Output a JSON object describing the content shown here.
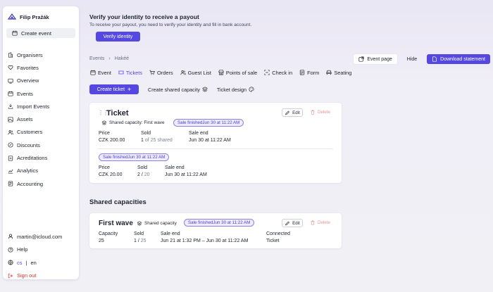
{
  "user": {
    "name": "Filip Pražák"
  },
  "sidebar": {
    "create_label": "Create event",
    "items": [
      {
        "label": "Organisers",
        "icon": "building-icon"
      },
      {
        "label": "Favorites",
        "icon": "heart-icon"
      },
      {
        "label": "Overview",
        "icon": "overview-icon"
      },
      {
        "label": "Events",
        "icon": "calendar-icon"
      },
      {
        "label": "Import Events",
        "icon": "import-icon"
      },
      {
        "label": "Assets",
        "icon": "assets-icon"
      },
      {
        "label": "Customers",
        "icon": "users-icon"
      },
      {
        "label": "Discounts",
        "icon": "discount-icon"
      },
      {
        "label": "Acreditations",
        "icon": "badge-icon"
      },
      {
        "label": "Analytics",
        "icon": "chart-icon"
      },
      {
        "label": "Accounting",
        "icon": "accounting-icon"
      }
    ],
    "email": "martin@icloud.com",
    "help": "Help",
    "lang_cs": "cs",
    "lang_sep": "|",
    "lang_en": "en",
    "signout": "Sign out"
  },
  "banner": {
    "title": "Verify your identity to receive a payout",
    "subtitle": "To receive your payout, you need to verify your identity and fill in bank account.",
    "button": "Verify identity"
  },
  "breadcrumb": {
    "root": "Events",
    "sep": "›",
    "current": "Hakéé"
  },
  "top_actions": {
    "event_page": "Event page",
    "hide": "Hide",
    "download": "Download statement"
  },
  "tabs": [
    {
      "label": "Event",
      "icon": "event-icon"
    },
    {
      "label": "Tickets",
      "icon": "ticket-icon"
    },
    {
      "label": "Orders",
      "icon": "cart-icon"
    },
    {
      "label": "Guest List",
      "icon": "guests-icon"
    },
    {
      "label": "Points of sale",
      "icon": "store-icon"
    },
    {
      "label": "Check in",
      "icon": "scan-icon"
    },
    {
      "label": "Form",
      "icon": "form-icon"
    },
    {
      "label": "Seating",
      "icon": "seat-icon"
    }
  ],
  "active_tab": "Tickets",
  "toolbar": {
    "create_ticket": "Create ticket",
    "plus": "+",
    "create_shared": "Create shared capacity",
    "ticket_design": "Ticket design"
  },
  "ticket": {
    "drag": "⋮⋮",
    "title": "Ticket",
    "edit": "Edit",
    "delete": "Delete",
    "shared_capacity": "Shared capacity: First wave",
    "status_pill": "Sale finishedJun 30 at 11:22 AM",
    "row1": {
      "price_label": "Price",
      "price": "CZK 200.00",
      "sold_label": "Sold",
      "sold": "1",
      "sold_suffix": "of 25 shared",
      "end_label": "Sale end",
      "end": "Jun 30 at 11:22 AM"
    },
    "row2_pill": "Sale finishedJun 30 at 11:22 AM",
    "row2": {
      "price_label": "Price",
      "price": "CZK 20.00",
      "sold_label": "Sold",
      "sold": "2 /",
      "sold_total": "20",
      "end_label": "Sale end",
      "end": "Jun 30 at 11:22 AM"
    }
  },
  "shared_capacities": {
    "heading": "Shared capacities",
    "item": {
      "title": "First wave",
      "tag": "Shared capacity",
      "pill": "Sale finishedJun 30 at 11:22 AM",
      "edit": "Edit",
      "delete": "Delete",
      "capacity_label": "Capacity",
      "capacity": "25",
      "sold_label": "Sold",
      "sold": "1 /",
      "sold_total": "25",
      "sale_end_label": "Sale end",
      "sale_end": "Jun 21 at 1:32 PM – Jun 30 at 11:22 AM",
      "connected_label": "Connected",
      "connected": "Ticket"
    }
  },
  "colors": {
    "accent": "#5548e0",
    "danger": "#d0362c",
    "pill_bg": "#eeecfd"
  }
}
